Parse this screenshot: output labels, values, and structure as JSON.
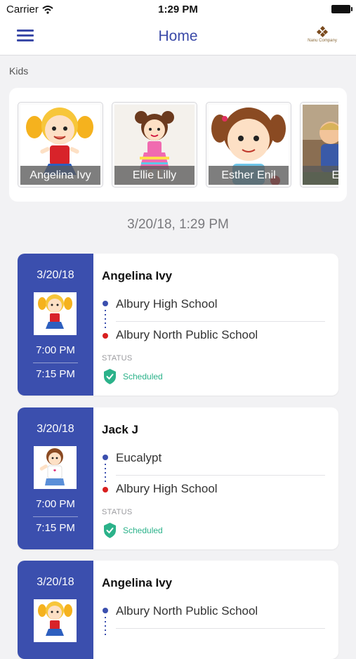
{
  "status_bar": {
    "carrier": "Carrier",
    "time": "1:29 PM"
  },
  "nav": {
    "title": "Home",
    "logo_text": "Nanu Company"
  },
  "kids": {
    "label": "Kids",
    "items": [
      {
        "name": "Angelina Ivy"
      },
      {
        "name": "Ellie Lilly"
      },
      {
        "name": "Esther Enil"
      },
      {
        "name": "Evie"
      }
    ]
  },
  "date_heading": "3/20/18, 1:29 PM",
  "trips": [
    {
      "date": "3/20/18",
      "name": "Angelina Ivy",
      "from": "Albury High School",
      "to": "Albury North Public School",
      "start": "7:00 PM",
      "end": "7:15 PM",
      "status_label": "STATUS",
      "status": "Scheduled"
    },
    {
      "date": "3/20/18",
      "name": "Jack J",
      "from": "Eucalypt",
      "to": "Albury High School",
      "start": "7:00 PM",
      "end": "7:15 PM",
      "status_label": "STATUS",
      "status": "Scheduled"
    },
    {
      "date": "3/20/18",
      "name": "Angelina Ivy",
      "from": "Albury North Public School",
      "to": "",
      "start": "",
      "end": "",
      "status_label": "",
      "status": ""
    }
  ],
  "colors": {
    "primary": "#3b4fae",
    "accent_red": "#d81f1f",
    "status_green": "#2bb28a"
  }
}
